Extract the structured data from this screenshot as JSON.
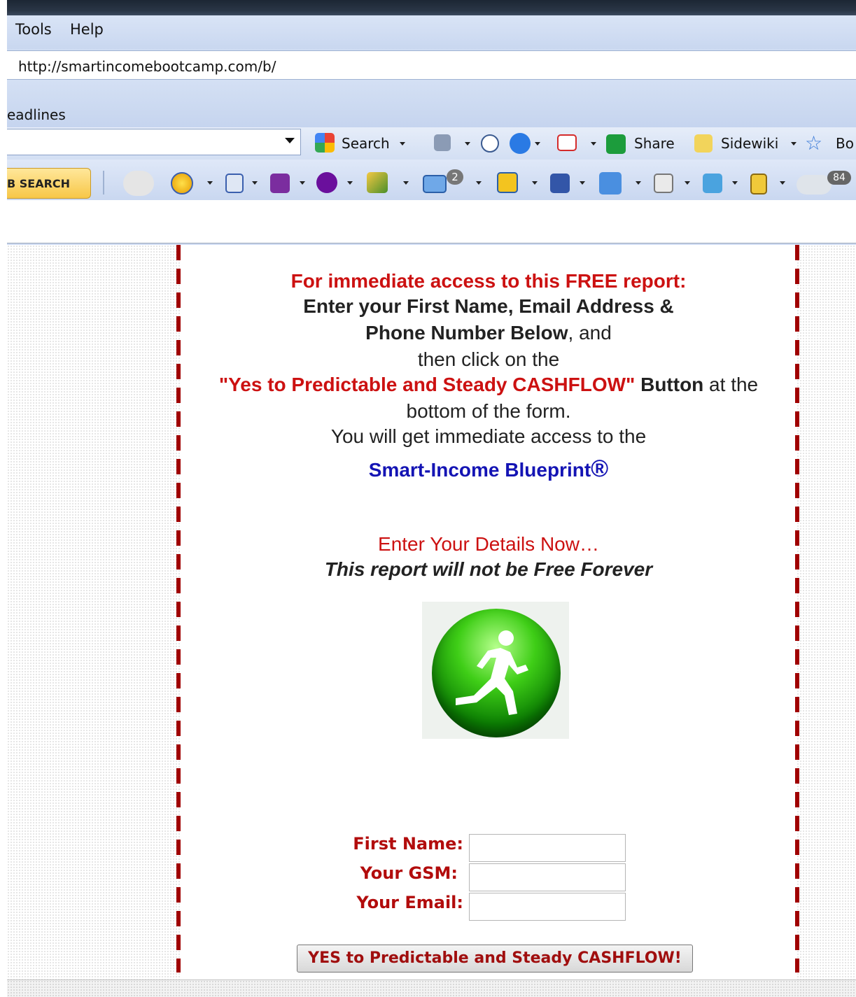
{
  "menu": {
    "items": [
      {
        "label": "Tools"
      },
      {
        "label": "Help"
      }
    ]
  },
  "address_bar": {
    "url": "http://smartincomebootcamp.com/b/"
  },
  "links_bar": {
    "label": "eadlines"
  },
  "toolbar1": {
    "search_label": "Search",
    "share_label": "Share",
    "sidewiki_label": "Sidewiki",
    "bookmarks_label": "Bo"
  },
  "toolbar2": {
    "search_button": "B SEARCH",
    "mail_count": "2",
    "weather_temp": "84"
  },
  "page": {
    "line1": "For immediate access to this FREE report:",
    "line2": "Enter your First Name, Email Address &",
    "line3_bold": "Phone Number Below",
    "line3_rest": ", and",
    "line4": "then click on the",
    "line5_quote": "\"Yes to Predictable and Steady CASHFLOW\"",
    "line5_button": "Button",
    "line5_rest": " at the",
    "line6": "bottom of the form.",
    "line7": "You will get immediate access to the",
    "product": "Smart-Income Blueprint",
    "registered": "®",
    "cta": "Enter Your Details Now…",
    "warning": "This report will not be Free Forever"
  },
  "form": {
    "first_name_label": "First Name:",
    "first_name_value": "",
    "gsm_label": "Your GSM:",
    "gsm_value": "",
    "email_label": "Your Email:",
    "email_value": "",
    "submit_label": "YES to Predictable and Steady CASHFLOW!"
  },
  "colors": {
    "accent_red": "#cc1111",
    "dark_red": "#a00e0e",
    "link_blue": "#1414b4",
    "dashed_border": "#a00000",
    "runner_green": "#3fce17"
  },
  "icons": [
    "google-icon",
    "bookmark-star-icon",
    "smiley-icon",
    "yahoo-icon",
    "mail-icon",
    "weather-icon",
    "runner-icon"
  ]
}
